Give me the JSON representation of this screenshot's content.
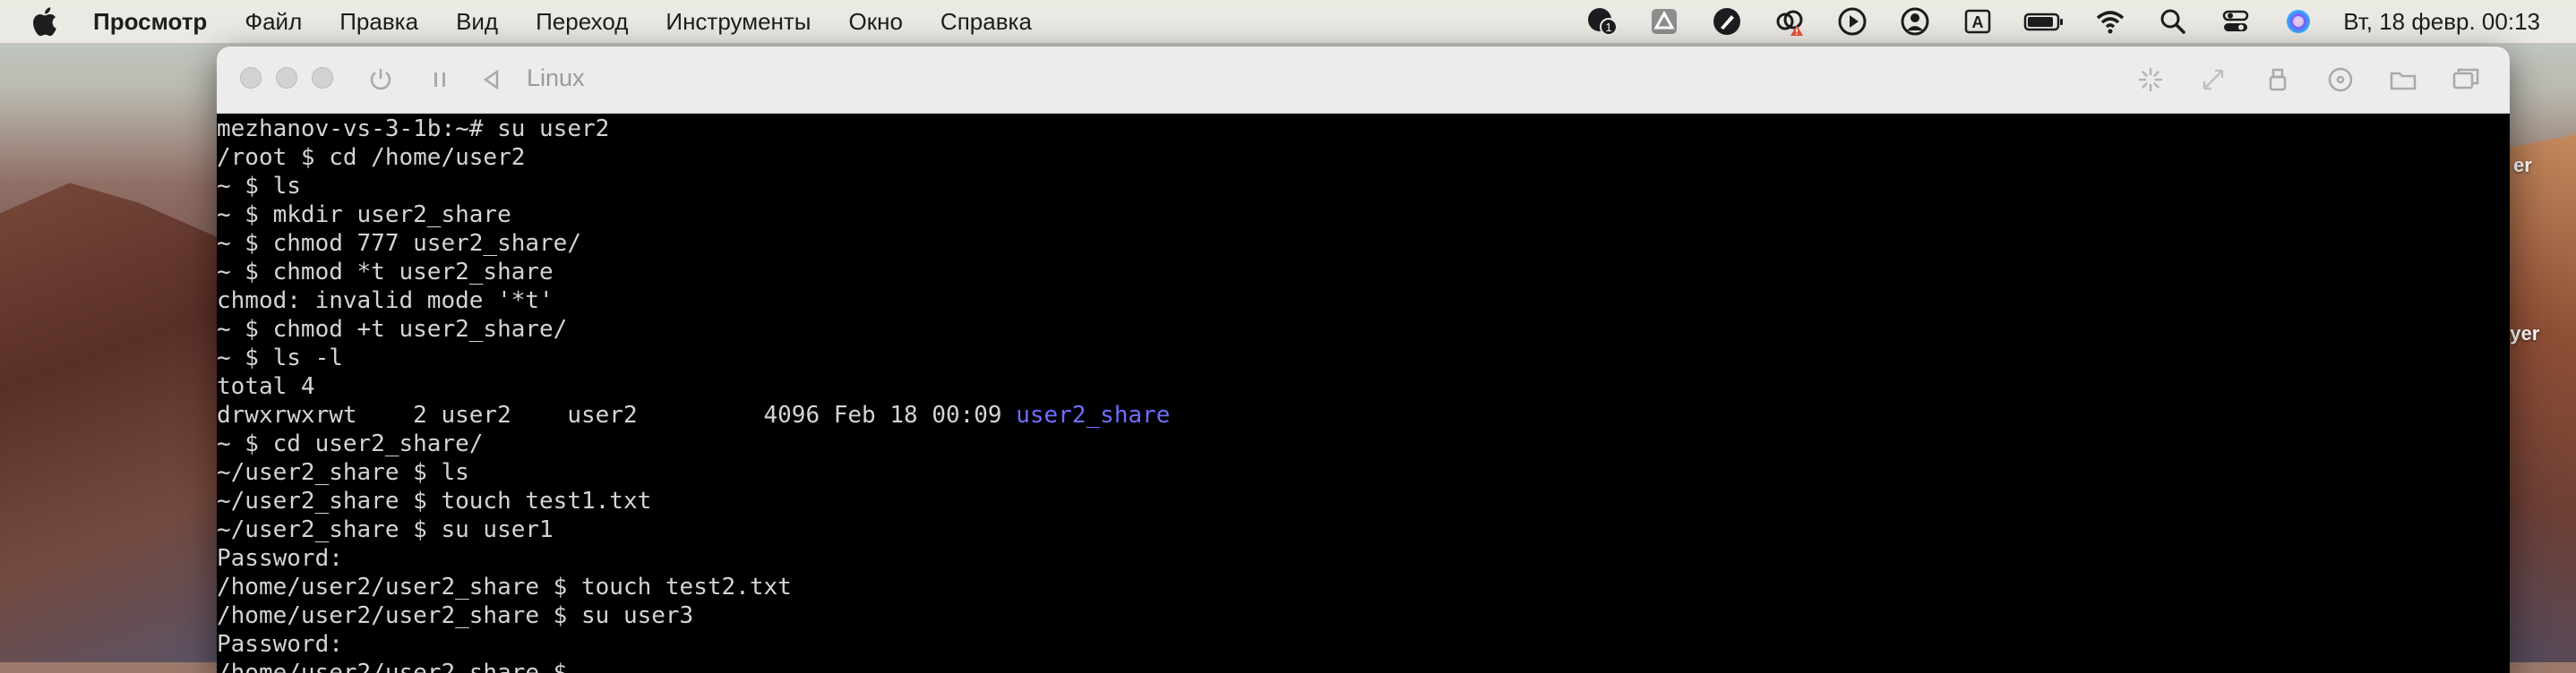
{
  "menubar": {
    "app_name": "Просмотр",
    "items": [
      "Файл",
      "Правка",
      "Вид",
      "Переход",
      "Инструменты",
      "Окно",
      "Справка"
    ],
    "icons": [
      "notification-badge-icon",
      "google-drive-icon",
      "pen-icon",
      "creative-cloud-alert-icon",
      "play-icon",
      "user-icon",
      "keyboard-input-icon",
      "battery-icon",
      "wifi-icon",
      "search-icon",
      "control-center-icon",
      "siri-icon"
    ],
    "input_source_label": "A",
    "badge_count": "1",
    "clock": "Вт, 18 февр.  00:13"
  },
  "desktop": {
    "partial_labels": [
      "er",
      "ayer"
    ]
  },
  "window": {
    "title": "Linux"
  },
  "terminal": {
    "lines": [
      "mezhanov-vs-3-1b:~# su user2",
      "/root $ cd /home/user2",
      "~ $ ls",
      "~ $ mkdir user2_share",
      "~ $ chmod 777 user2_share/",
      "~ $ chmod *t user2_share",
      "chmod: invalid mode '*t'",
      "~ $ chmod +t user2_share/",
      "~ $ ls -l",
      "total 4",
      "drwxrwxrwt    2 user2    user2         4096 Feb 18 00:09 ",
      "~ $ cd user2_share/",
      "~/user2_share $ ls",
      "~/user2_share $ touch test1.txt",
      "~/user2_share $ su user1",
      "Password:",
      "/home/user2/user2_share $ touch test2.txt",
      "/home/user2/user2_share $ su user3",
      "Password:",
      "/home/user2/user2_share $ "
    ],
    "ls_directory": "user2_share"
  }
}
